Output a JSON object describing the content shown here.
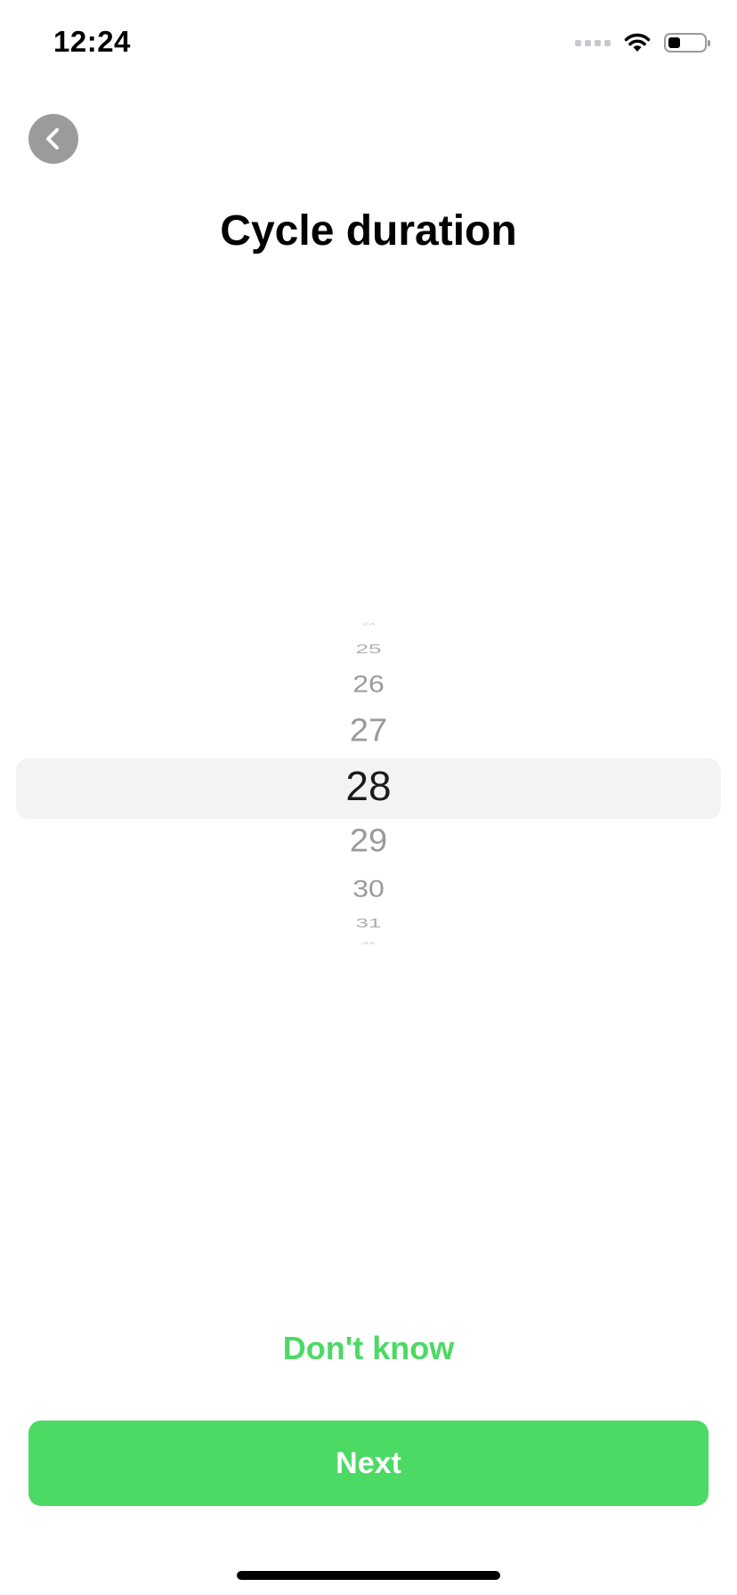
{
  "status_bar": {
    "time": "12:24",
    "battery_level": 0.35,
    "icons": [
      "cellular-signal-icon",
      "wifi-icon",
      "battery-icon"
    ]
  },
  "header": {
    "back_icon": "chevron-left-icon",
    "title": "Cycle duration"
  },
  "picker": {
    "selected_value": "28",
    "visible_values": [
      "24",
      "25",
      "26",
      "27",
      "28",
      "29",
      "30",
      "31",
      "32"
    ]
  },
  "actions": {
    "dont_know_label": "Don't know",
    "next_label": "Next"
  },
  "colors": {
    "accent": "#4cd964",
    "back_button": "#9b9b9b",
    "picker_highlight": "#f3f3f4"
  }
}
